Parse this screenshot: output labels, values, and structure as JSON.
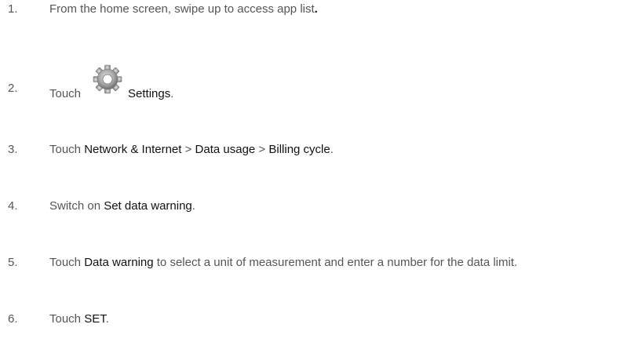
{
  "steps": [
    {
      "number": "1.",
      "parts": [
        {
          "text": "From the home screen, swipe up to access app list",
          "bold": false
        },
        {
          "text": ".",
          "bold": true
        }
      ]
    },
    {
      "number": "2.",
      "before_icon": "Touch",
      "icon": "settings-gear-icon",
      "after_icon": "Settings",
      "tail": "."
    },
    {
      "number": "3.",
      "parts": [
        {
          "text": "Touch ",
          "bold": false
        },
        {
          "text": "Network & Internet",
          "bold": true
        },
        {
          "text": " > ",
          "bold": false
        },
        {
          "text": "Data usage",
          "bold": true
        },
        {
          "text": " > ",
          "bold": false
        },
        {
          "text": "Billing cycle",
          "bold": true
        },
        {
          "text": ".",
          "bold": false
        }
      ]
    },
    {
      "number": "4.",
      "parts": [
        {
          "text": "Switch on ",
          "bold": false
        },
        {
          "text": "Set data warning",
          "bold": true
        },
        {
          "text": ".",
          "bold": false
        }
      ]
    },
    {
      "number": "5.",
      "parts": [
        {
          "text": "Touch ",
          "bold": false
        },
        {
          "text": "Data warning",
          "bold": true
        },
        {
          "text": " to select a unit of measurement and enter a number for the data limit.",
          "bold": false
        }
      ]
    },
    {
      "number": "6.",
      "parts": [
        {
          "text": "Touch ",
          "bold": false
        },
        {
          "text": "SET",
          "bold": true
        },
        {
          "text": ".",
          "bold": false
        }
      ]
    }
  ]
}
